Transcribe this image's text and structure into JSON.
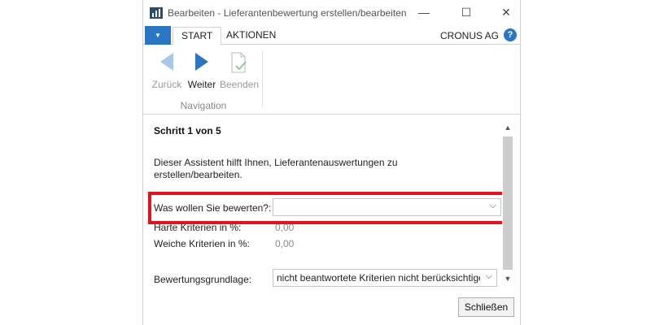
{
  "window": {
    "title": "Bearbeiten - Lieferantenbewertung erstellen/bearbeiten",
    "minimize_glyph": "—",
    "maximize_glyph": "☐",
    "close_glyph": "✕"
  },
  "tabs": {
    "menu_glyph": "▼",
    "items": [
      {
        "label": "START"
      },
      {
        "label": "AKTIONEN"
      }
    ],
    "company": "CRONUS AG",
    "help_glyph": "?"
  },
  "ribbon": {
    "buttons": [
      {
        "label": "Zurück",
        "icon": "back-arrow-icon",
        "enabled": false
      },
      {
        "label": "Weiter",
        "icon": "forward-arrow-icon",
        "enabled": true
      },
      {
        "label": "Beenden",
        "icon": "finish-document-icon",
        "enabled": false
      }
    ],
    "group_label": "Navigation"
  },
  "content": {
    "step_title": "Schritt 1 von 5",
    "intro_text": "Dieser Assistent hilft Ihnen, Lieferantenauswertungen zu erstellen/bearbeiten.",
    "fields": {
      "evaluate": {
        "label": "Was wollen Sie bewerten?:",
        "value": ""
      },
      "hard_criteria": {
        "label": "Harte Kriterien in %:",
        "value": "0,00"
      },
      "soft_criteria": {
        "label": "Weiche Kriterien in %:",
        "value": "0,00"
      },
      "basis": {
        "label": "Bewertungsgrundlage:",
        "value": "nicht beantwortete Kriterien nicht berücksichtigen"
      }
    },
    "highlight_color": "#e0141e"
  },
  "footer": {
    "close_label": "Schließen"
  },
  "colors": {
    "accent": "#2a75c4",
    "disabled_icon": "#a9c7e6"
  }
}
